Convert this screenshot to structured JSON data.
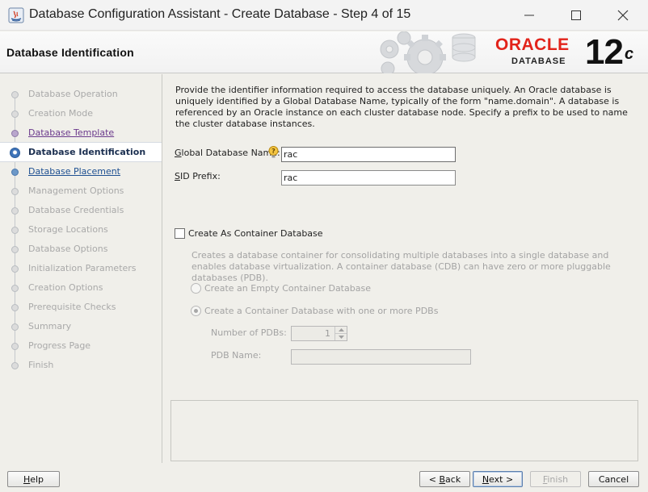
{
  "window": {
    "title": "Database Configuration Assistant - Create Database - Step 4 of 15"
  },
  "header": {
    "page_title": "Database Identification",
    "brand": "ORACLE",
    "brand_sub": "DATABASE",
    "version": "12",
    "version_suffix": "c",
    "brand_color": "#e2231a"
  },
  "nav": {
    "items": [
      {
        "label": "Database Operation",
        "state": "disabled"
      },
      {
        "label": "Creation Mode",
        "state": "disabled"
      },
      {
        "label": "Database Template",
        "state": "visited"
      },
      {
        "label": "Database Identification",
        "state": "active"
      },
      {
        "label": "Database Placement",
        "state": "link"
      },
      {
        "label": "Management Options",
        "state": "disabled"
      },
      {
        "label": "Database Credentials",
        "state": "disabled"
      },
      {
        "label": "Storage Locations",
        "state": "disabled"
      },
      {
        "label": "Database Options",
        "state": "disabled"
      },
      {
        "label": "Initialization Parameters",
        "state": "disabled"
      },
      {
        "label": "Creation Options",
        "state": "disabled"
      },
      {
        "label": "Prerequisite Checks",
        "state": "disabled"
      },
      {
        "label": "Summary",
        "state": "disabled"
      },
      {
        "label": "Progress Page",
        "state": "disabled"
      },
      {
        "label": "Finish",
        "state": "disabled"
      }
    ]
  },
  "main": {
    "description": "Provide the identifier information required to access the database uniquely. An Oracle database is uniquely identified by a Global Database Name, typically of the form \"name.domain\". A database is referenced by an Oracle instance on each cluster database node. Specify a prefix to be used to name the cluster database instances.",
    "global_db_name_label": "Global Database Name:",
    "global_db_name_value": "rac",
    "sid_prefix_label": "SID Prefix:",
    "sid_prefix_value": "rac",
    "cdb_checkbox_label": "Create As Container Database",
    "cdb_checked": false,
    "cdb_description": "Creates a database container for consolidating multiple databases into a single database and enables database virtualization. A container database (CDB) can have zero or more pluggable databases (PDB).",
    "empty_cdb_label": "Create an Empty Container Database",
    "with_pdbs_label": "Create a Container Database with one or more PDBs",
    "num_pdbs_label": "Number of PDBs:",
    "num_pdbs_value": "1",
    "pdb_name_label": "PDB Name:",
    "pdb_name_value": ""
  },
  "buttons": {
    "help": "Help",
    "back": "< Back",
    "next": "Next >",
    "finish": "Finish",
    "cancel": "Cancel"
  }
}
